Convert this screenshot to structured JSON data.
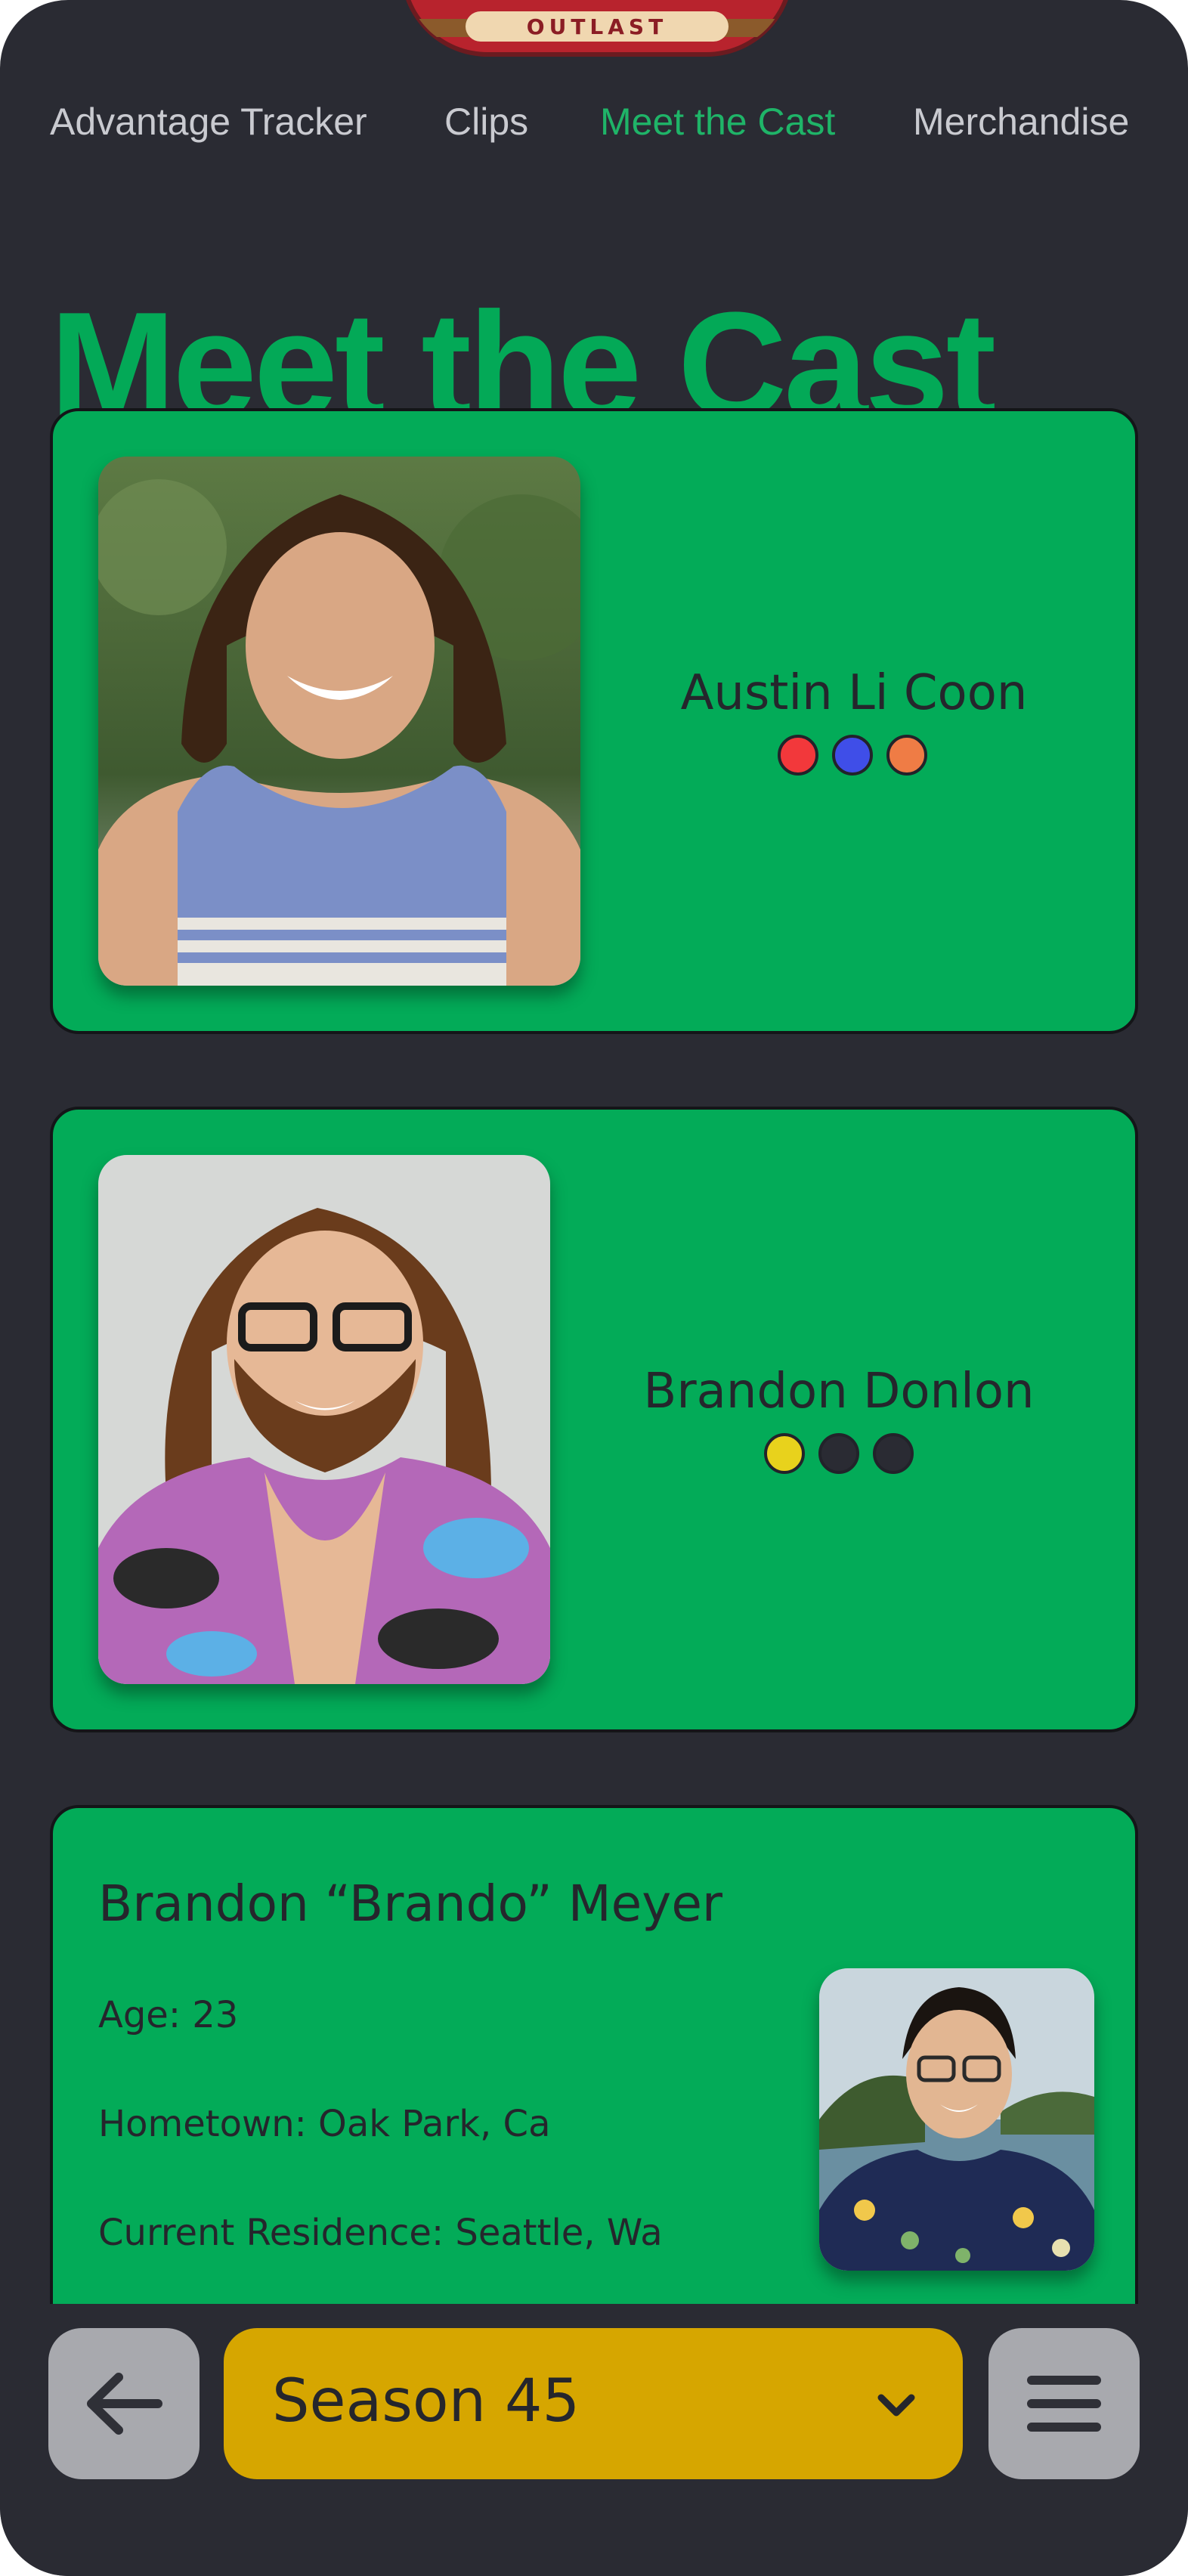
{
  "logo": {
    "text": "OUTLAST"
  },
  "nav": {
    "items": [
      {
        "label": "Advantage Tracker",
        "active": false
      },
      {
        "label": "Clips",
        "active": false
      },
      {
        "label": "Meet the Cast",
        "active": true
      },
      {
        "label": "Merchandise",
        "active": false
      }
    ]
  },
  "page_title": "Meet the Cast",
  "cast": [
    {
      "name": "Austin Li Coon",
      "dots": [
        "#f2383b",
        "#3f4ee8",
        "#ef7c45"
      ]
    },
    {
      "name": "Brandon Donlon",
      "dots": [
        "#e8d21c",
        "#2a2b33",
        "#2a2b33"
      ]
    }
  ],
  "detail": {
    "name": "Brandon “Brando” Meyer",
    "age": "Age: 23",
    "hometown": "Hometown: Oak Park, Ca",
    "residence": "Current Residence: Seattle, Wa"
  },
  "bottom": {
    "season_label": "Season 45",
    "back_icon": "arrow-left-icon",
    "menu_icon": "hamburger-menu-icon"
  },
  "colors": {
    "background": "#2a2b33",
    "accent_green": "#03a957",
    "card_green": "#03ab58",
    "season_yellow": "#d6a600",
    "button_gray": "#a8a9ae"
  }
}
